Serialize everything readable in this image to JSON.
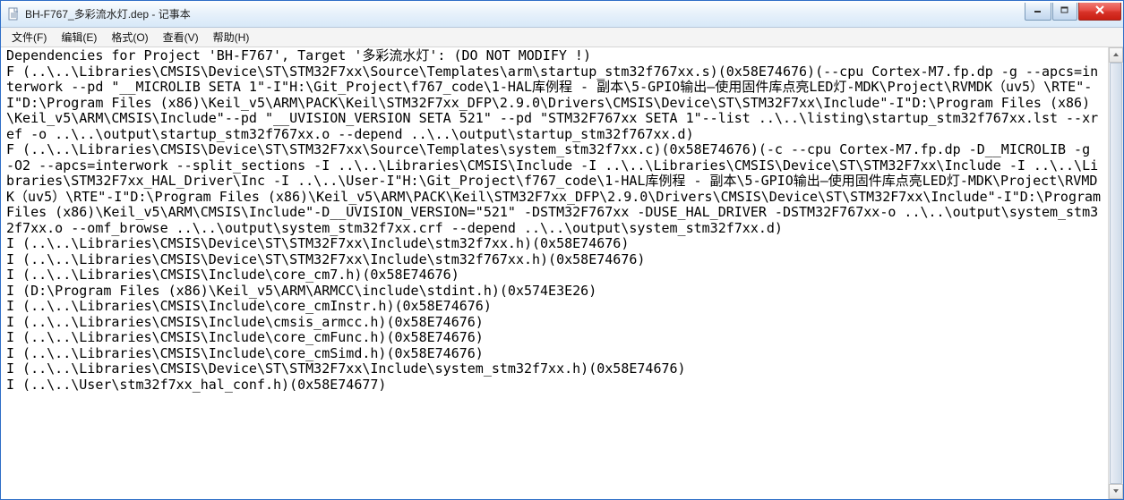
{
  "window": {
    "title": "BH-F767_多彩流水灯.dep - 记事本"
  },
  "menu": {
    "file": "文件(F)",
    "edit": "编辑(E)",
    "format": "格式(O)",
    "view": "查看(V)",
    "help": "帮助(H)"
  },
  "content": "Dependencies for Project 'BH-F767', Target '多彩流水灯': (DO NOT MODIFY !)\nF (..\\..\\Libraries\\CMSIS\\Device\\ST\\STM32F7xx\\Source\\Templates\\arm\\startup_stm32f767xx.s)(0x58E74676)(--cpu Cortex-M7.fp.dp -g --apcs=interwork --pd \"__MICROLIB SETA 1\"-I\"H:\\Git_Project\\f767_code\\1-HAL库例程 - 副本\\5-GPIO输出—使用固件库点亮LED灯-MDK\\Project\\RVMDK（uv5）\\RTE\"-I\"D:\\Program Files (x86)\\Keil_v5\\ARM\\PACK\\Keil\\STM32F7xx_DFP\\2.9.0\\Drivers\\CMSIS\\Device\\ST\\STM32F7xx\\Include\"-I\"D:\\Program Files (x86)\\Keil_v5\\ARM\\CMSIS\\Include\"--pd \"__UVISION_VERSION SETA 521\" --pd \"STM32F767xx SETA 1\"--list ..\\..\\listing\\startup_stm32f767xx.lst --xref -o ..\\..\\output\\startup_stm32f767xx.o --depend ..\\..\\output\\startup_stm32f767xx.d)\nF (..\\..\\Libraries\\CMSIS\\Device\\ST\\STM32F7xx\\Source\\Templates\\system_stm32f7xx.c)(0x58E74676)(-c --cpu Cortex-M7.fp.dp -D__MICROLIB -g -O2 --apcs=interwork --split_sections -I ..\\..\\Libraries\\CMSIS\\Include -I ..\\..\\Libraries\\CMSIS\\Device\\ST\\STM32F7xx\\Include -I ..\\..\\Libraries\\STM32F7xx_HAL_Driver\\Inc -I ..\\..\\User-I\"H:\\Git_Project\\f767_code\\1-HAL库例程 - 副本\\5-GPIO输出—使用固件库点亮LED灯-MDK\\Project\\RVMDK（uv5）\\RTE\"-I\"D:\\Program Files (x86)\\Keil_v5\\ARM\\PACK\\Keil\\STM32F7xx_DFP\\2.9.0\\Drivers\\CMSIS\\Device\\ST\\STM32F7xx\\Include\"-I\"D:\\Program Files (x86)\\Keil_v5\\ARM\\CMSIS\\Include\"-D__UVISION_VERSION=\"521\" -DSTM32F767xx -DUSE_HAL_DRIVER -DSTM32F767xx-o ..\\..\\output\\system_stm32f7xx.o --omf_browse ..\\..\\output\\system_stm32f7xx.crf --depend ..\\..\\output\\system_stm32f7xx.d)\nI (..\\..\\Libraries\\CMSIS\\Device\\ST\\STM32F7xx\\Include\\stm32f7xx.h)(0x58E74676)\nI (..\\..\\Libraries\\CMSIS\\Device\\ST\\STM32F7xx\\Include\\stm32f767xx.h)(0x58E74676)\nI (..\\..\\Libraries\\CMSIS\\Include\\core_cm7.h)(0x58E74676)\nI (D:\\Program Files (x86)\\Keil_v5\\ARM\\ARMCC\\include\\stdint.h)(0x574E3E26)\nI (..\\..\\Libraries\\CMSIS\\Include\\core_cmInstr.h)(0x58E74676)\nI (..\\..\\Libraries\\CMSIS\\Include\\cmsis_armcc.h)(0x58E74676)\nI (..\\..\\Libraries\\CMSIS\\Include\\core_cmFunc.h)(0x58E74676)\nI (..\\..\\Libraries\\CMSIS\\Include\\core_cmSimd.h)(0x58E74676)\nI (..\\..\\Libraries\\CMSIS\\Device\\ST\\STM32F7xx\\Include\\system_stm32f7xx.h)(0x58E74676)\nI (..\\..\\User\\stm32f7xx_hal_conf.h)(0x58E74677)"
}
